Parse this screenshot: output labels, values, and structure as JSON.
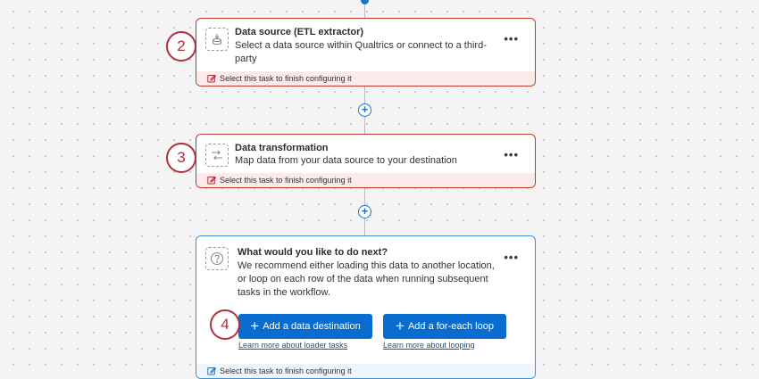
{
  "tasks": [
    {
      "title": "Data source (ETL extractor)",
      "description": "Select a data source within Qualtrics or connect to a third-party",
      "footer": "Select this task to finish configuring it",
      "icon": "database-download-icon",
      "step": "2"
    },
    {
      "title": "Data transformation",
      "description": "Map data from your data source to your destination",
      "footer": "Select this task to finish configuring it",
      "icon": "arrows-transform-icon",
      "step": "3"
    }
  ],
  "next": {
    "title": "What would you like to do next?",
    "description": "We recommend either loading this data to another location, or loop on each row of the data when running subsequent tasks in the workflow.",
    "desc_lines": [
      "We recommend either loading this data to another location,",
      "or loop on each row of the data when running subsequent",
      "tasks in the workflow."
    ],
    "footer": "Select this task to finish configuring it",
    "icon": "question-circle-icon",
    "step": "4",
    "destination_button": "Add a data destination",
    "loop_button": "Add a for-each loop",
    "loader_link": "Learn more about loader tasks",
    "looping_link": "Learn more about looping"
  },
  "more_label": "•••",
  "add_symbol": "+",
  "colors": {
    "error_border": "#c0392b",
    "step_badge": "#b32d3b",
    "accent_blue": "#0b6ccf",
    "active_border": "#3d8fd8"
  }
}
